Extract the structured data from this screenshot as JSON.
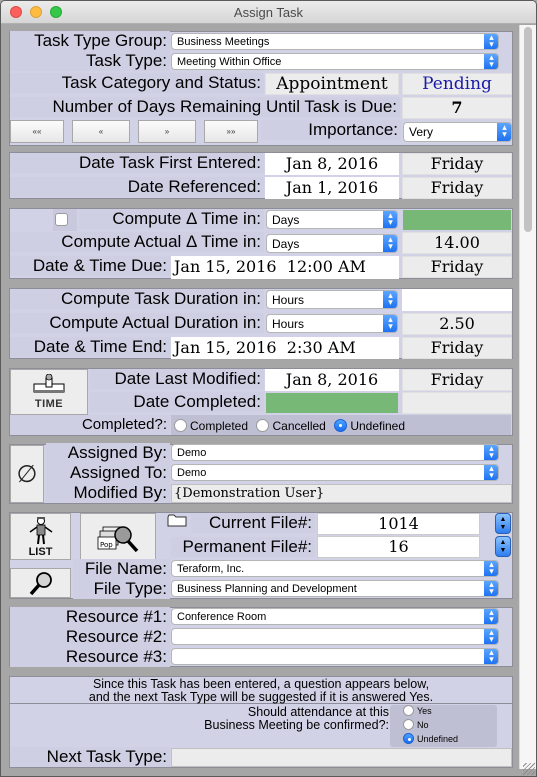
{
  "window": {
    "title": "Assign Task"
  },
  "task": {
    "type_group_label": "Task Type Group:",
    "type_group_value": "Business Meetings",
    "type_label": "Task Type:",
    "type_value": "Meeting Within Office",
    "category_status_label": "Task Category and Status:",
    "category_value": "Appointment",
    "status_value": "Pending",
    "status_color": "#1a1aa8",
    "days_remaining_label": "Number of Days Remaining Until Task is Due:",
    "days_remaining_value": "7"
  },
  "nav": {
    "first_label": "««",
    "prev_label": "«",
    "next_label": "»",
    "last_label": "»»"
  },
  "importance": {
    "label": "Importance:",
    "value": "Very"
  },
  "dates": {
    "first_entered_label": "Date Task First Entered:",
    "first_entered_value": "Jan 8, 2016",
    "first_entered_day": "Friday",
    "referenced_label": "Date Referenced:",
    "referenced_value": "Jan 1, 2016",
    "referenced_day": "Friday"
  },
  "delta": {
    "compute_label": "Compute Δ Time in:",
    "compute_value": "Days",
    "compute_result": "",
    "actual_label": "Compute Actual Δ Time in:",
    "actual_value": "Days",
    "actual_result": "14.00",
    "due_label": "Date & Time Due:",
    "due_value": "Jan 15, 2016  12:00 AM",
    "due_day": "Friday",
    "checkbox_checked": false
  },
  "duration": {
    "compute_label": "Compute Task Duration in:",
    "compute_value": "Hours",
    "compute_result": "",
    "actual_label": "Compute Actual Duration in:",
    "actual_value": "Hours",
    "actual_result": "2.50",
    "end_label": "Date & Time End:",
    "end_value": "Jan 15, 2016  2:30 AM",
    "end_day": "Friday"
  },
  "modified": {
    "time_button_label": "TIME",
    "last_modified_label": "Date Last Modified:",
    "last_modified_value": "Jan 8, 2016",
    "last_modified_day": "Friday",
    "completed_date_label": "Date Completed:",
    "completed_date_value": "",
    "completed_date_day": "",
    "completed_label": "Completed?:",
    "completed_options": [
      "Completed",
      "Cancelled",
      "Undefined"
    ],
    "completed_selected": "Undefined"
  },
  "assignment": {
    "null_symbol": "∅",
    "assigned_by_label": "Assigned By:",
    "assigned_by_value": "Demo",
    "assigned_to_label": "Assigned To:",
    "assigned_to_value": "Demo",
    "modified_by_label": "Modified By:",
    "modified_by_value": "{Demonstration User}"
  },
  "file": {
    "list_button_label": "LIST",
    "pop_label": "Pop",
    "current_label": "Current File#:",
    "current_value": "1014",
    "permanent_label": "Permanent File#:",
    "permanent_value": "16",
    "name_label": "File Name:",
    "name_value": "Teraform, Inc.",
    "type_label": "File Type:",
    "type_value": "Business Planning and Development"
  },
  "resources": [
    {
      "label": "Resource #1:",
      "value": "Conference Room"
    },
    {
      "label": "Resource #2:",
      "value": ""
    },
    {
      "label": "Resource #3:",
      "value": ""
    }
  ],
  "question": {
    "note_line1": "Since this Task has been entered, a question appears below,",
    "note_line2": "and the next Task Type will be suggested if it is answered Yes.",
    "prompt_line1": "Should attendance at this",
    "prompt_line2": "Business Meeting be confirmed?:",
    "options": [
      "Yes",
      "No",
      "Undefined"
    ],
    "selected": "Undefined",
    "next_task_label": "Next Task Type:",
    "next_task_value": ""
  },
  "colors": {
    "panel": "#d2d2e6",
    "green_field": "#77b877",
    "accent": "#1c6df0"
  }
}
